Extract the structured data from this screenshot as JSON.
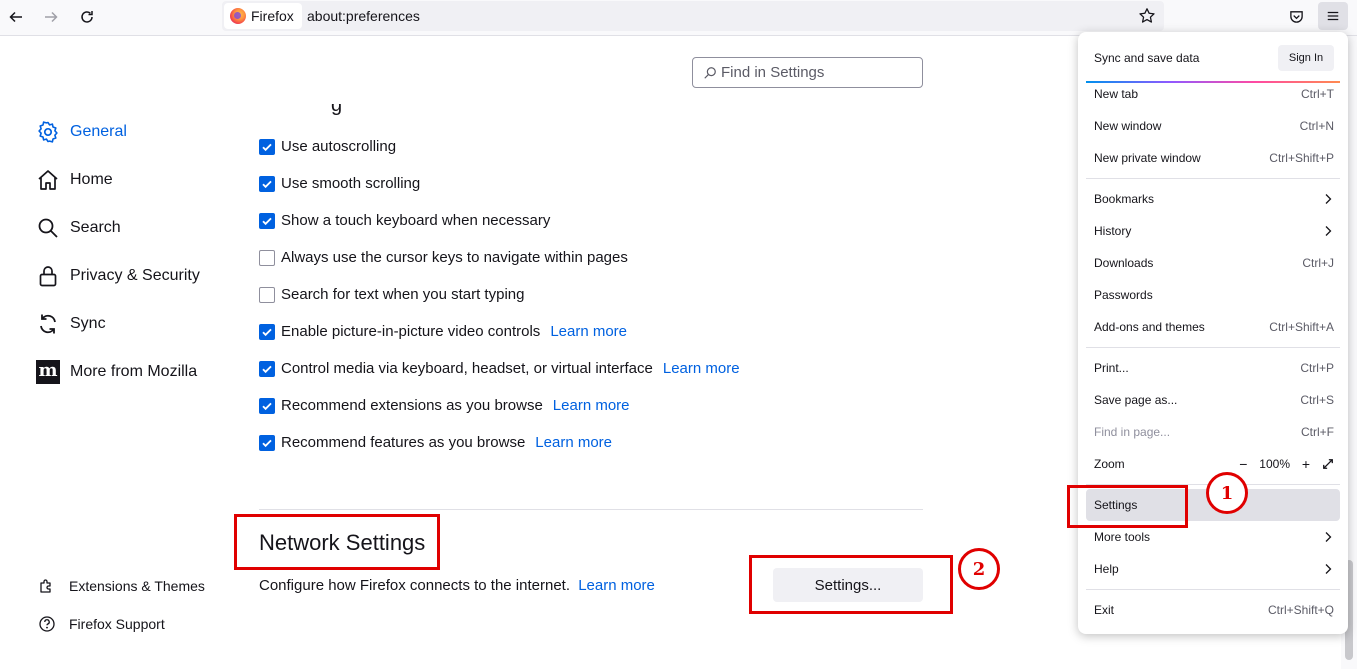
{
  "browser": {
    "identity_label": "Firefox",
    "url": "about:preferences"
  },
  "find": {
    "placeholder": "Find in Settings"
  },
  "sidebar": {
    "items": [
      {
        "label": "General",
        "icon": "gear-icon",
        "selected": true
      },
      {
        "label": "Home",
        "icon": "home-icon"
      },
      {
        "label": "Search",
        "icon": "search-icon"
      },
      {
        "label": "Privacy & Security",
        "icon": "lock-icon"
      },
      {
        "label": "Sync",
        "icon": "sync-icon"
      },
      {
        "label": "More from Mozilla",
        "icon": "mozilla-logo"
      }
    ],
    "footer": [
      {
        "label": "Extensions & Themes",
        "icon": "puzzle-icon"
      },
      {
        "label": "Firefox Support",
        "icon": "help-icon"
      }
    ]
  },
  "browsing": {
    "options": [
      {
        "label": "Use autoscrolling",
        "checked": true,
        "link": ""
      },
      {
        "label": "Use smooth scrolling",
        "checked": true,
        "link": ""
      },
      {
        "label": "Show a touch keyboard when necessary",
        "checked": true,
        "link": ""
      },
      {
        "label": "Always use the cursor keys to navigate within pages",
        "checked": false,
        "link": ""
      },
      {
        "label": "Search for text when you start typing",
        "checked": false,
        "link": ""
      },
      {
        "label": "Enable picture-in-picture video controls",
        "checked": true,
        "link": "Learn more"
      },
      {
        "label": "Control media via keyboard, headset, or virtual interface",
        "checked": true,
        "link": "Learn more"
      },
      {
        "label": "Recommend extensions as you browse",
        "checked": true,
        "link": "Learn more"
      },
      {
        "label": "Recommend features as you browse",
        "checked": true,
        "link": "Learn more"
      }
    ]
  },
  "network": {
    "title": "Network Settings",
    "description": "Configure how Firefox connects to the internet.",
    "learn_more": "Learn more",
    "button": "Settings..."
  },
  "annotations": {
    "step1": "1",
    "step2": "2",
    "color": "#e00000"
  },
  "menu": {
    "sync_label": "Sync and save data",
    "sign_in": "Sign In",
    "items": [
      {
        "label": "New tab",
        "shortcut": "Ctrl+T"
      },
      {
        "label": "New window",
        "shortcut": "Ctrl+N"
      },
      {
        "label": "New private window",
        "shortcut": "Ctrl+Shift+P"
      },
      {
        "label": "Bookmarks",
        "shortcut": ""
      },
      {
        "label": "History",
        "shortcut": ""
      },
      {
        "label": "Downloads",
        "shortcut": "Ctrl+J"
      },
      {
        "label": "Passwords",
        "shortcut": ""
      },
      {
        "label": "Add-ons and themes",
        "shortcut": "Ctrl+Shift+A"
      },
      {
        "label": "Print...",
        "shortcut": "Ctrl+P"
      },
      {
        "label": "Save page as...",
        "shortcut": "Ctrl+S"
      },
      {
        "label": "Find in page...",
        "shortcut": "Ctrl+F"
      },
      {
        "label": "Zoom",
        "shortcut": ""
      },
      {
        "label": "Settings",
        "shortcut": ""
      },
      {
        "label": "More tools",
        "shortcut": ""
      },
      {
        "label": "Help",
        "shortcut": ""
      },
      {
        "label": "Exit",
        "shortcut": "Ctrl+Shift+Q"
      }
    ],
    "zoom_level": "100%",
    "zoom_minus": "−",
    "zoom_plus": "+"
  },
  "colors": {
    "accent": "#0061e0",
    "annotation": "#e00000"
  }
}
